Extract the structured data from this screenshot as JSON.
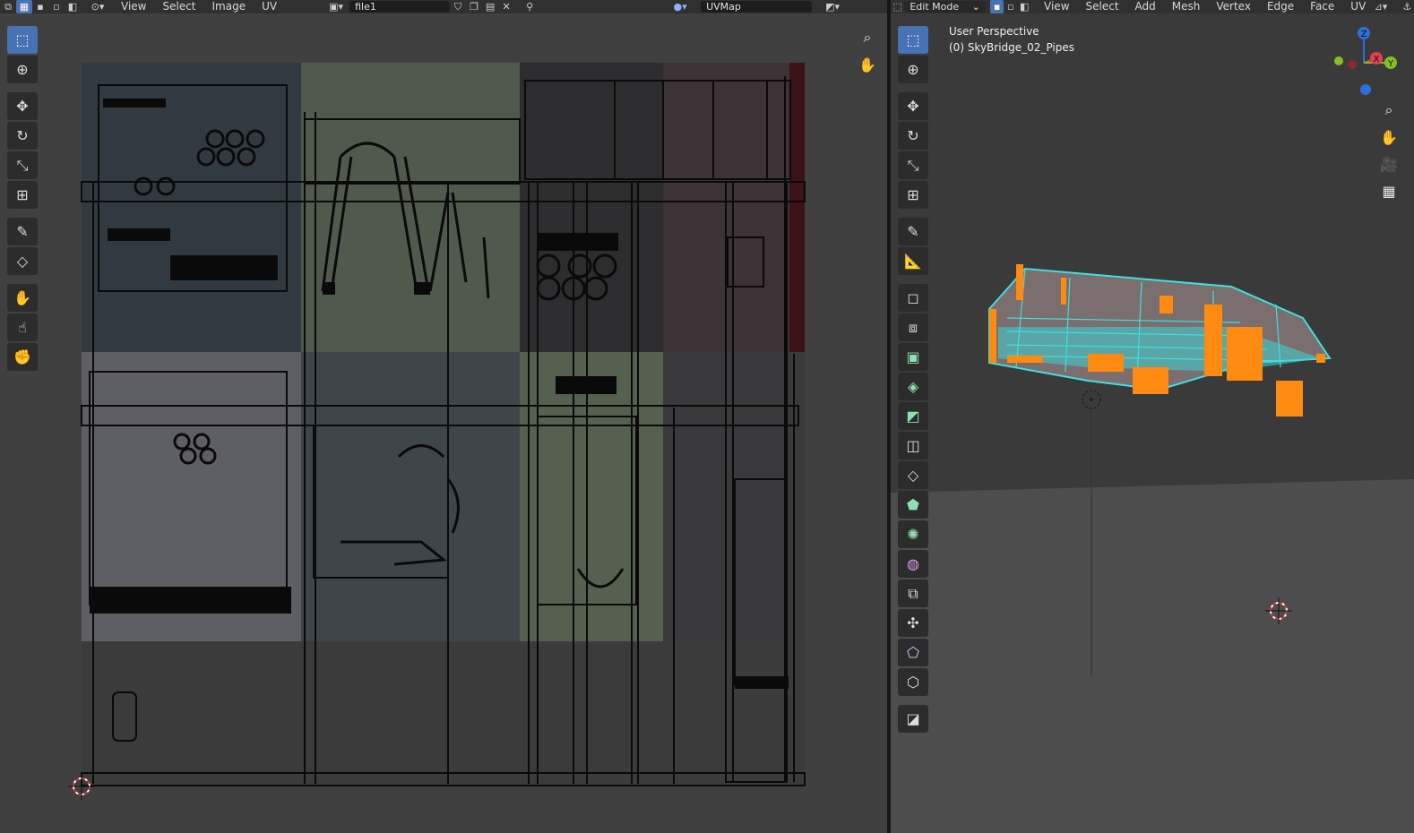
{
  "uv_editor": {
    "menu": [
      "View",
      "Select",
      "Image",
      "UV"
    ],
    "image_name": "file1",
    "uv_map": "UVMap",
    "icons": [
      "uv-sync-icon",
      "select-vertex-icon",
      "select-edge-icon",
      "select-face-icon",
      "select-island-icon",
      "pivot-icon",
      "image-browse-icon",
      "fake-user-icon",
      "new-image-icon",
      "open-image-icon",
      "close-icon",
      "pin-icon",
      "display-channels-icon"
    ],
    "tools": [
      "select-box-icon",
      "cursor-icon",
      "move-icon",
      "rotate-icon",
      "scale-icon",
      "transform-icon",
      "annotate-icon",
      "rip-icon",
      "grab-icon",
      "relax-icon",
      "pinch-icon"
    ],
    "nav": [
      "zoom-icon",
      "hand-icon"
    ],
    "texture_tiles": [
      [
        "#323a41",
        "#4f5a4c",
        "#2d2d2f",
        "#3d3235"
      ],
      [
        "#5e5e65",
        "#3e454b",
        "#55604f",
        "#3a3a3d"
      ],
      [
        "#3b3b3b",
        "#3b3b3b",
        "#3b3b3b",
        "#3b3b3b"
      ]
    ]
  },
  "viewport": {
    "mode": "Edit Mode",
    "menu": [
      "View",
      "Select",
      "Add",
      "Mesh",
      "Vertex",
      "Edge",
      "Face",
      "UV"
    ],
    "perspective_label": "User Perspective",
    "object_label": "(0) SkyBridge_02_Pipes",
    "gizmo": {
      "z": "Z",
      "x": "X",
      "y": "Y",
      "colors": {
        "z": "#2f6fd9",
        "x": "#e04050",
        "y": "#84c11e"
      }
    },
    "tools": [
      "select-box-icon",
      "cursor-icon",
      "move-icon",
      "rotate-icon",
      "scale-icon",
      "transform-icon",
      "annotate-icon",
      "measure-icon",
      "add-cube-icon",
      "extrude-icon",
      "extrude-region-icon",
      "inset-icon",
      "bevel-icon",
      "loop-cut-icon",
      "knife-icon",
      "poly-build-icon",
      "spin-icon",
      "smooth-icon",
      "edge-slide-icon",
      "shrink-fatten-icon",
      "shear-icon",
      "rip-region-icon"
    ],
    "nav": [
      "zoom-icon",
      "hand-icon",
      "camera-icon",
      "grid-icon"
    ],
    "colors": {
      "mesh_face": "#40e0e0",
      "selected_vertex": "#ff8a12",
      "floor": "#505050",
      "sky": "#3a3a3a"
    }
  }
}
